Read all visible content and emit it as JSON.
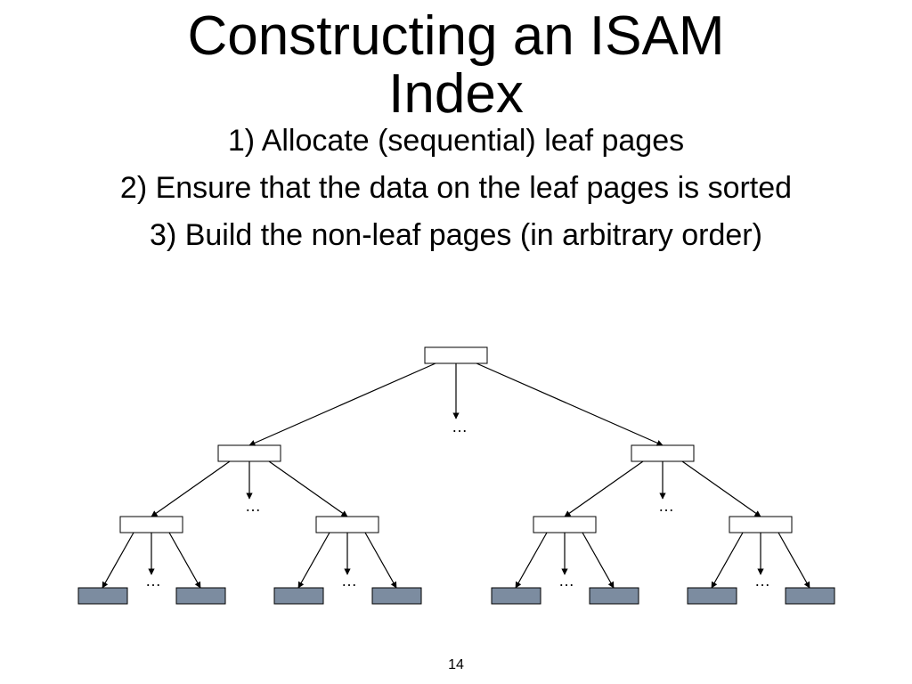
{
  "title_line1": "Constructing an ISAM",
  "title_line2": "Index",
  "steps": {
    "s1": "1) Allocate (sequential) leaf pages",
    "s2": "2) Ensure that the data on the leaf pages is sorted",
    "s3": "3) Build the non-leaf pages (in arbitrary order)"
  },
  "ellipsis": "…",
  "page_number": "14"
}
